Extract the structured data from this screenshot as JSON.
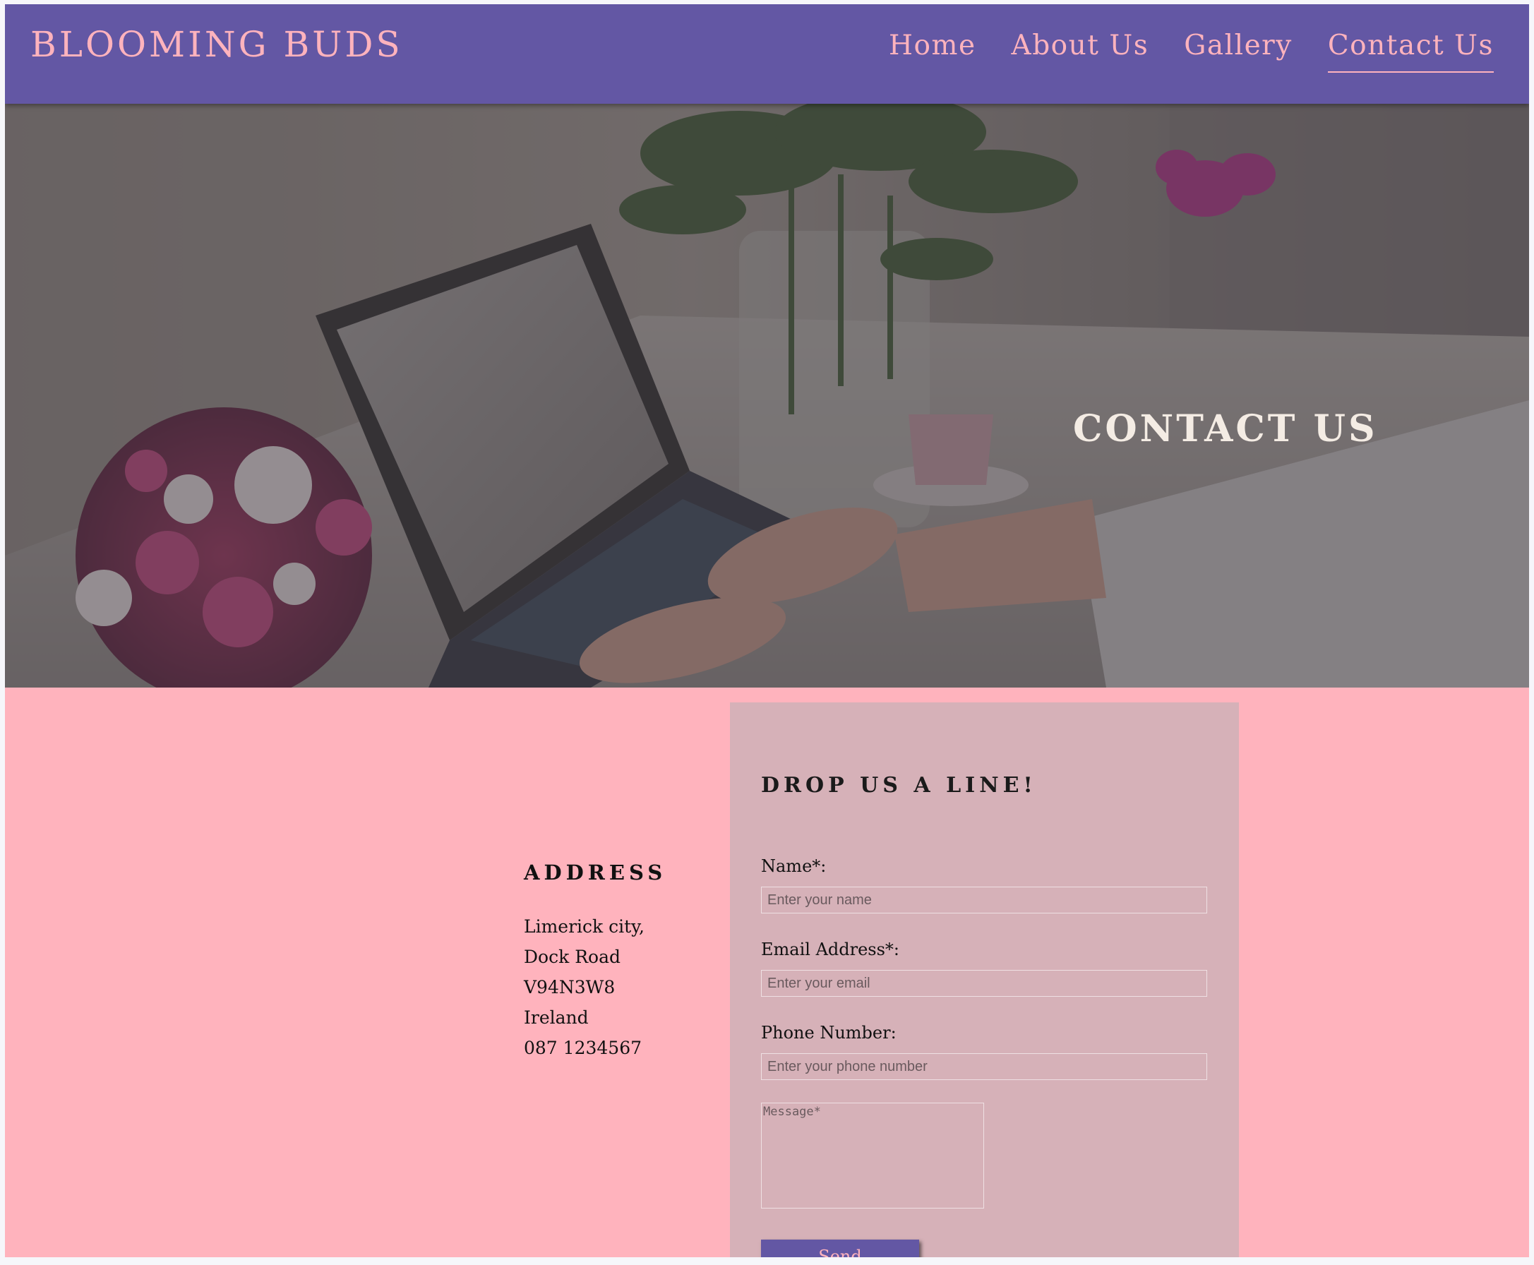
{
  "header": {
    "brand": "BLOOMING BUDS",
    "nav": [
      "Home",
      "About Us",
      "Gallery",
      "Contact Us"
    ],
    "active_nav": "Contact Us"
  },
  "hero": {
    "title": "CONTACT US",
    "image_description_icon": "laptop-flowers-photo"
  },
  "address": {
    "heading": "ADDRESS",
    "lines": [
      "Limerick city,",
      "Dock Road",
      "V94N3W8",
      "Ireland",
      "087 1234567"
    ]
  },
  "form": {
    "title": "DROP US A LINE!",
    "name_label": "Name*:",
    "name_placeholder": "Enter your name",
    "email_label": "Email Address*:",
    "email_placeholder": "Enter your email",
    "phone_label": "Phone Number:",
    "phone_placeholder": "Enter your phone number",
    "message_placeholder": "Message*",
    "send_label": "Send"
  },
  "colors": {
    "header_bg": "#6357a4",
    "brand_pink": "#ffb3bd",
    "page_pink": "#ffb3bd",
    "form_card_bg": "#d6b1b8"
  }
}
